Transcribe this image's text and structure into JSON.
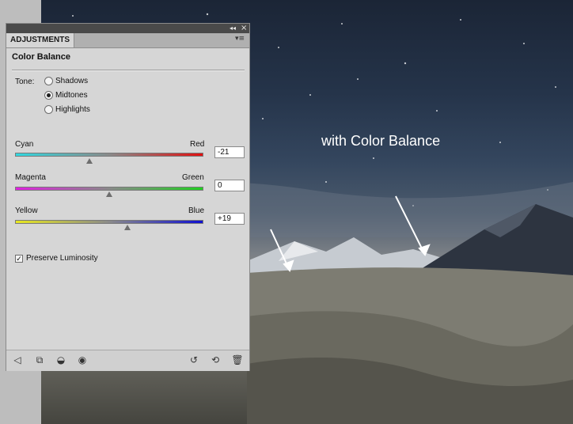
{
  "panel": {
    "tab_label": "ADJUSTMENTS",
    "collapse_glyph": "◂◂",
    "close_glyph": "×",
    "menu_glyph": "▾≡",
    "title": "Color Balance"
  },
  "tone": {
    "label": "Tone:",
    "options": [
      {
        "label": "Shadows",
        "selected": false
      },
      {
        "label": "Midtones",
        "selected": true
      },
      {
        "label": "Highlights",
        "selected": false
      }
    ]
  },
  "sliders": [
    {
      "left_label": "Cyan",
      "right_label": "Red",
      "value": "-21",
      "numeric": -21,
      "left_color": "#30d8e0",
      "right_color": "#e01010"
    },
    {
      "left_label": "Magenta",
      "right_label": "Green",
      "value": "0",
      "numeric": 0,
      "left_color": "#e020e0",
      "right_color": "#20d020"
    },
    {
      "left_label": "Yellow",
      "right_label": "Blue",
      "value": "+19",
      "numeric": 19,
      "left_color": "#e8e820",
      "right_color": "#1010d0"
    }
  ],
  "preserve": {
    "label": "Preserve Luminosity",
    "checked": true
  },
  "toolbar": {
    "icons": [
      "back-arrow-icon",
      "clip-to-layer-icon",
      "mask-toggle-icon",
      "visibility-eye-icon",
      "view-previous-state-icon",
      "reset-icon",
      "trash-icon"
    ]
  },
  "caption": "with Color Balance"
}
